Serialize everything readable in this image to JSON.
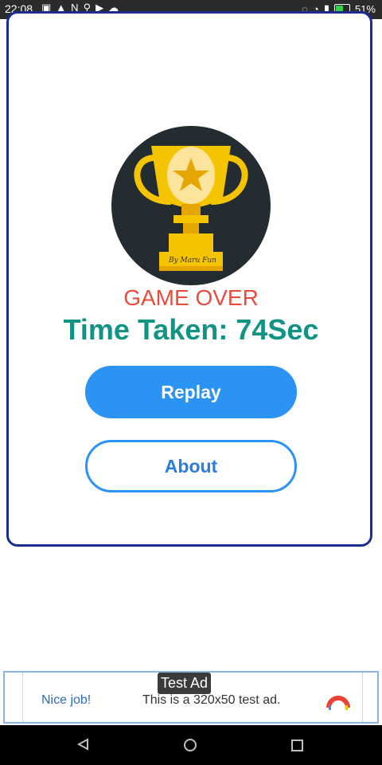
{
  "status_bar": {
    "time": "22:08",
    "left_icons": [
      "gallery-icon",
      "alert-icon",
      "n-icon",
      "usb-icon",
      "play-icon",
      "cloud-icon"
    ],
    "battery_percent": "51%",
    "signal": "wifi"
  },
  "result": {
    "title": "GAME OVER",
    "time_taken": "Time Taken: 74Sec",
    "trophy_caption": "By Maru Fun"
  },
  "buttons": {
    "replay_label": "Replay",
    "about_label": "About"
  },
  "ad": {
    "badge": "Test Ad",
    "nice": "Nice job!",
    "text": "This is a 320x50 test ad."
  },
  "colors": {
    "card_border": "#1c2c8f",
    "game_over": "#e74c3c",
    "time_taken": "#129484",
    "button_primary": "#2a93f4"
  }
}
